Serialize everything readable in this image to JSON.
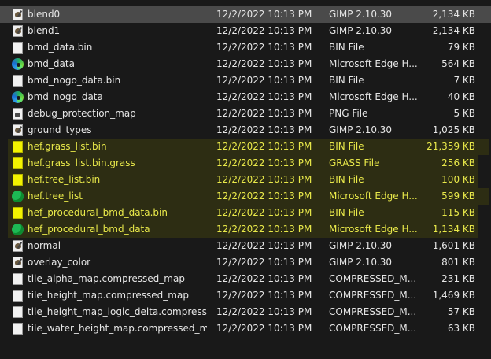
{
  "files": [
    {
      "name": "blend0",
      "date": "12/2/2022 10:13 PM",
      "type": "GIMP 2.10.30",
      "size": "2,134 KB",
      "icon": "gimp-file-icon",
      "selected": true,
      "highlight": false
    },
    {
      "name": "blend1",
      "date": "12/2/2022 10:13 PM",
      "type": "GIMP 2.10.30",
      "size": "2,134 KB",
      "icon": "gimp-file-icon",
      "highlight": false
    },
    {
      "name": "bmd_data.bin",
      "date": "12/2/2022 10:13 PM",
      "type": "BIN File",
      "size": "79 KB",
      "icon": "blank-file-icon",
      "highlight": false
    },
    {
      "name": "bmd_data",
      "date": "12/2/2022 10:13 PM",
      "type": "Microsoft Edge H...",
      "size": "564 KB",
      "icon": "edge-icon",
      "highlight": false
    },
    {
      "name": "bmd_nogo_data.bin",
      "date": "12/2/2022 10:13 PM",
      "type": "BIN File",
      "size": "7 KB",
      "icon": "blank-file-icon",
      "highlight": false
    },
    {
      "name": "bmd_nogo_data",
      "date": "12/2/2022 10:13 PM",
      "type": "Microsoft Edge H...",
      "size": "40 KB",
      "icon": "edge-icon",
      "highlight": false
    },
    {
      "name": "debug_protection_map",
      "date": "12/2/2022 10:13 PM",
      "type": "PNG File",
      "size": "5 KB",
      "icon": "png-file-icon",
      "highlight": false
    },
    {
      "name": "ground_types",
      "date": "12/2/2022 10:13 PM",
      "type": "GIMP 2.10.30",
      "size": "1,025 KB",
      "icon": "gimp-file-icon",
      "highlight": false
    },
    {
      "name": "hef.grass_list.bin",
      "date": "12/2/2022 10:13 PM",
      "type": "BIN File",
      "size": "21,359 KB",
      "icon": "highlighted-file-icon",
      "highlight": true,
      "ext": true
    },
    {
      "name": "hef.grass_list.bin.grass",
      "date": "12/2/2022 10:13 PM",
      "type": "GRASS File",
      "size": "256 KB",
      "icon": "highlighted-file-icon",
      "highlight": true
    },
    {
      "name": "hef.tree_list.bin",
      "date": "12/2/2022 10:13 PM",
      "type": "BIN File",
      "size": "100 KB",
      "icon": "highlighted-file-icon",
      "highlight": true
    },
    {
      "name": "hef.tree_list",
      "date": "12/2/2022 10:13 PM",
      "type": "Microsoft Edge H...",
      "size": "599 KB",
      "icon": "highlighted-edge-icon",
      "highlight": true,
      "ext": true
    },
    {
      "name": "hef_procedural_bmd_data.bin",
      "date": "12/2/2022 10:13 PM",
      "type": "BIN File",
      "size": "115 KB",
      "icon": "highlighted-file-icon",
      "highlight": true
    },
    {
      "name": "hef_procedural_bmd_data",
      "date": "12/2/2022 10:13 PM",
      "type": "Microsoft Edge H...",
      "size": "1,134 KB",
      "icon": "highlighted-edge-icon",
      "highlight": true
    },
    {
      "name": "normal",
      "date": "12/2/2022 10:13 PM",
      "type": "GIMP 2.10.30",
      "size": "1,601 KB",
      "icon": "gimp-file-icon",
      "highlight": false
    },
    {
      "name": "overlay_color",
      "date": "12/2/2022 10:13 PM",
      "type": "GIMP 2.10.30",
      "size": "801 KB",
      "icon": "gimp-file-icon",
      "highlight": false
    },
    {
      "name": "tile_alpha_map.compressed_map",
      "date": "12/2/2022 10:13 PM",
      "type": "COMPRESSED_M...",
      "size": "231 KB",
      "icon": "blank-file-icon",
      "highlight": false
    },
    {
      "name": "tile_height_map.compressed_map",
      "date": "12/2/2022 10:13 PM",
      "type": "COMPRESSED_M...",
      "size": "1,469 KB",
      "icon": "blank-file-icon",
      "highlight": false
    },
    {
      "name": "tile_height_map_logic_delta.compressed...",
      "date": "12/2/2022 10:13 PM",
      "type": "COMPRESSED_M...",
      "size": "57 KB",
      "icon": "blank-file-icon",
      "highlight": false
    },
    {
      "name": "tile_water_height_map.compressed_map",
      "date": "12/2/2022 10:13 PM",
      "type": "COMPRESSED_M...",
      "size": "63 KB",
      "icon": "blank-file-icon",
      "highlight": false
    }
  ],
  "colors": {
    "background": "#191919",
    "selected_row": "#4a4a4a",
    "highlight_text": "#e9e94a",
    "text": "#e6e6e6"
  }
}
